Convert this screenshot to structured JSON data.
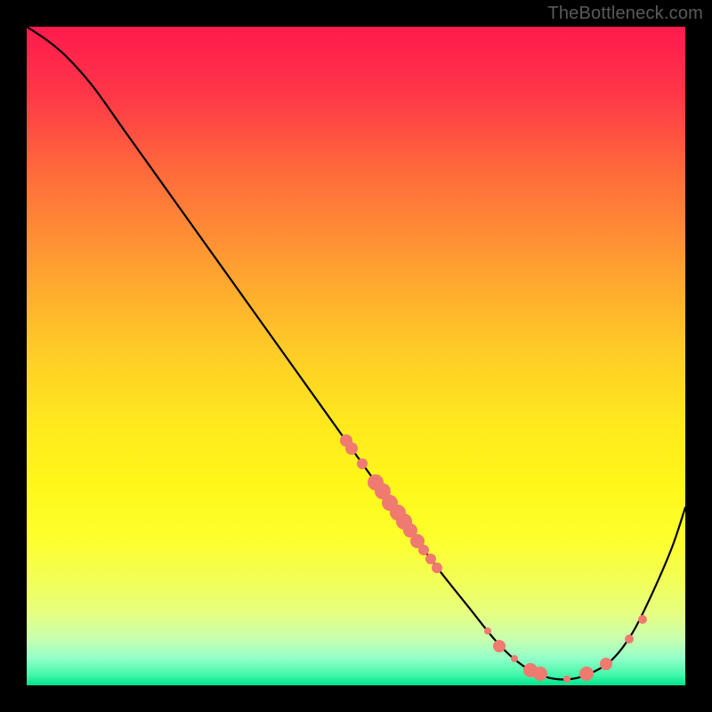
{
  "watermark": "TheBottleneck.com",
  "chart_data": {
    "type": "line",
    "title": "",
    "xlabel": "",
    "ylabel": "",
    "xlim": [
      0,
      100
    ],
    "ylim": [
      0,
      100
    ],
    "grid": false,
    "legend": false,
    "background": "rainbow-vertical-red-to-green",
    "curve": {
      "name": "bottleneck-curve",
      "x": [
        0,
        3,
        6,
        10,
        15,
        20,
        25,
        30,
        35,
        40,
        45,
        50,
        55,
        60,
        63,
        67,
        71,
        74,
        77,
        80,
        83,
        86,
        89,
        92,
        95,
        98,
        100
      ],
      "y": [
        100,
        98,
        95.5,
        91,
        84,
        77,
        70,
        63,
        56,
        49,
        42,
        35,
        28,
        21,
        17,
        12,
        7,
        4,
        2,
        1,
        1,
        2,
        4,
        8,
        14,
        21,
        27
      ]
    },
    "series": [
      {
        "name": "dots-on-curve",
        "marker": "circle",
        "color": "#ef7a6f",
        "points": [
          {
            "x": 48.5,
            "y": 37.1,
            "r": 7
          },
          {
            "x": 49.3,
            "y": 35.9,
            "r": 7
          },
          {
            "x": 51.0,
            "y": 33.6,
            "r": 6
          },
          {
            "x": 53.0,
            "y": 30.8,
            "r": 9
          },
          {
            "x": 54.0,
            "y": 29.4,
            "r": 9
          },
          {
            "x": 55.2,
            "y": 27.7,
            "r": 9
          },
          {
            "x": 56.3,
            "y": 26.2,
            "r": 9
          },
          {
            "x": 57.3,
            "y": 24.8,
            "r": 9
          },
          {
            "x": 58.2,
            "y": 23.5,
            "r": 8
          },
          {
            "x": 59.3,
            "y": 21.9,
            "r": 8
          },
          {
            "x": 60.3,
            "y": 20.6,
            "r": 6
          },
          {
            "x": 61.3,
            "y": 19.2,
            "r": 6
          },
          {
            "x": 62.3,
            "y": 17.9,
            "r": 6
          },
          {
            "x": 70.0,
            "y": 8.2,
            "r": 4
          },
          {
            "x": 71.8,
            "y": 6.0,
            "r": 7
          },
          {
            "x": 74.0,
            "y": 4.0,
            "r": 4
          },
          {
            "x": 76.5,
            "y": 2.3,
            "r": 8
          },
          {
            "x": 78.0,
            "y": 1.7,
            "r": 8
          },
          {
            "x": 82.0,
            "y": 1.0,
            "r": 4
          },
          {
            "x": 85.0,
            "y": 1.7,
            "r": 8
          },
          {
            "x": 88.0,
            "y": 3.3,
            "r": 7
          },
          {
            "x": 91.5,
            "y": 7.0,
            "r": 5
          },
          {
            "x": 93.5,
            "y": 10.0,
            "r": 5
          }
        ]
      }
    ]
  }
}
